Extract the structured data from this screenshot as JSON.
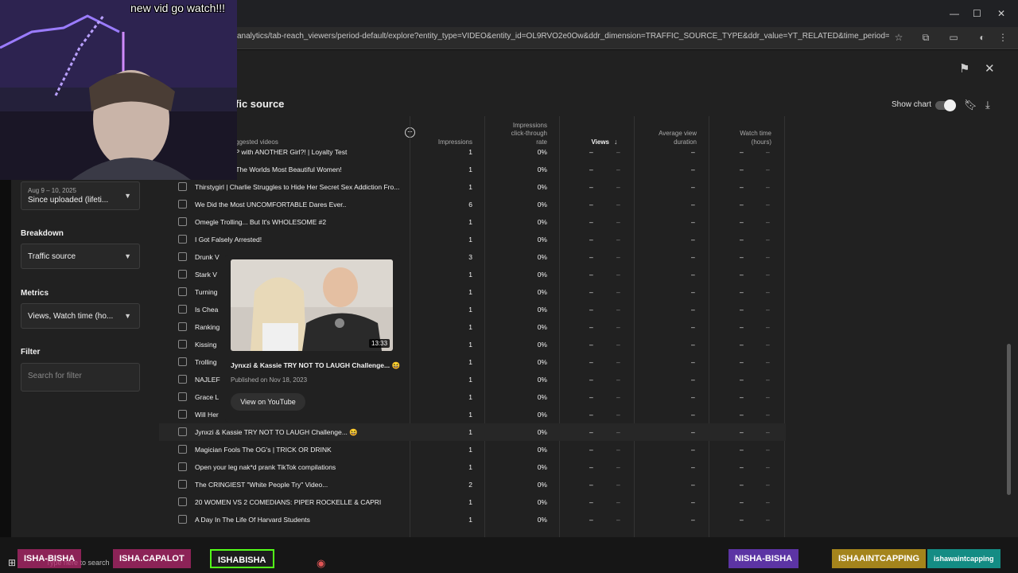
{
  "browser": {
    "url": "analytics/tab-reach_viewers/period-default/explore?entity_type=VIDEO&entity_id=OL9RVO2e0Ow&ddr_dimension=TRAFFIC_SOURCE_TYPE&ddr_value=YT_RELATED&time_period=lifetime&explor...",
    "min_icon": "—",
    "max_icon": "☐",
    "close_icon": "✕"
  },
  "overlay": {
    "stream_text": "new vid go watch!!!"
  },
  "page": {
    "title": "fic source",
    "show_chart_label": "Show chart"
  },
  "sidebar": {
    "date_range_sub": "Aug 9 – 10, 2025",
    "date_range_value": "Since uploaded (lifeti...",
    "breakdown_label": "Breakdown",
    "breakdown_value": "Traffic source",
    "metrics_label": "Metrics",
    "metrics_value": "Views, Watch time (ho...",
    "filter_label": "Filter",
    "filter_placeholder": "Search for filter"
  },
  "table": {
    "headers": {
      "col0": "ggested videos",
      "impressions": "Impressions",
      "ctr_line1": "Impressions",
      "ctr_line2": "click-through",
      "ctr_line3": "rate",
      "views": "Views",
      "avg_line1": "Average view",
      "avg_line2": "duration",
      "watch_line1": "Watch time",
      "watch_line2": "(hours)"
    },
    "rows": [
      {
        "title": "RIEND SLEEP with ANOTHER Girl?! | Loyalty Test",
        "impressions": "1",
        "ctr": "0%"
      },
      {
        "title": "Country With The Worlds Most Beautiful Women!",
        "impressions": "1",
        "ctr": "0%"
      },
      {
        "title": "Thirstygirl | Charlie Struggles to Hide Her Secret Sex Addiction Fro...",
        "impressions": "1",
        "ctr": "0%"
      },
      {
        "title": "We Did the Most UNCOMFORTABLE Dares Ever..",
        "impressions": "6",
        "ctr": "0%"
      },
      {
        "title": "Omegle Trolling... But It's WHOLESOME #2",
        "impressions": "1",
        "ctr": "0%"
      },
      {
        "title": "I Got Falsely Arrested!",
        "impressions": "1",
        "ctr": "0%"
      },
      {
        "title": "Drunk V",
        "impressions": "3",
        "ctr": "0%"
      },
      {
        "title": "Stark V",
        "impressions": "1",
        "ctr": "0%"
      },
      {
        "title": "Turning",
        "impressions": "1",
        "ctr": "0%"
      },
      {
        "title": "Is Chea",
        "impressions": "1",
        "ctr": "0%"
      },
      {
        "title": "Ranking",
        "impressions": "1",
        "ctr": "0%"
      },
      {
        "title": "Kissing",
        "impressions": "1",
        "ctr": "0%"
      },
      {
        "title": "Trolling",
        "impressions": "1",
        "ctr": "0%"
      },
      {
        "title": "NAJLEF",
        "impressions": "1",
        "ctr": "0%"
      },
      {
        "title": "Grace L",
        "impressions": "1",
        "ctr": "0%"
      },
      {
        "title": "Will Her",
        "impressions": "1",
        "ctr": "0%"
      },
      {
        "title": "Jynxzi & Kassie TRY NOT TO LAUGH Challenge... 😆",
        "impressions": "1",
        "ctr": "0%"
      },
      {
        "title": "Magician Fools The OG's | TRICK OR DRINK",
        "impressions": "1",
        "ctr": "0%"
      },
      {
        "title": "Open your leg nak*d prank TikTok compilations",
        "impressions": "1",
        "ctr": "0%"
      },
      {
        "title": "The CRINGIEST \"White People Try\" Video...",
        "impressions": "2",
        "ctr": "0%"
      },
      {
        "title": "20 WOMEN VS 2 COMEDIANS: PIPER ROCKELLE & CAPRI",
        "impressions": "1",
        "ctr": "0%"
      },
      {
        "title": "A Day In The Life Of Harvard Students",
        "impressions": "1",
        "ctr": "0%"
      }
    ],
    "dash": "–"
  },
  "card": {
    "duration": "13:33",
    "title": "Jynxzi & Kassie TRY NOT TO LAUGH Challenge... 😆",
    "published": "Published on Nov 18, 2023",
    "button": "View on YouTube"
  },
  "taskbar": {
    "search_placeholder": "Type here to search",
    "tags": [
      "ISHA-BISHA",
      "ISHA.CAPALOT",
      "ISHABISHA",
      "NISHA-BISHA",
      "ISHAAINTCAPPING",
      "ishawaintcapping"
    ]
  }
}
